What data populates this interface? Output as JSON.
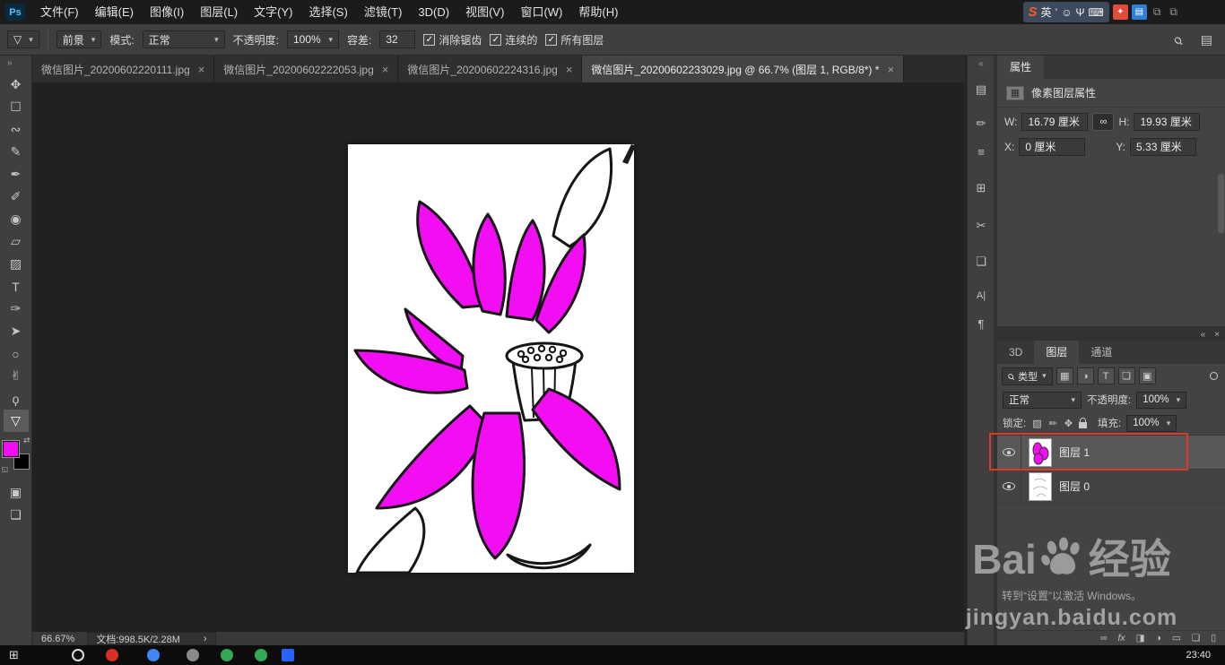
{
  "colors": {
    "flower": "#f20df2",
    "annotation": "#e0372b",
    "panel": "#434343",
    "menubar": "#1b1b1b"
  },
  "icons": {
    "ps_logo": "Ps",
    "collapse_right": "»",
    "collapse_left": "«",
    "close": "×",
    "arrow_down": "▾",
    "chevron_right": "›",
    "search": "ϙ",
    "check": "✓",
    "link": "∞",
    "swap": "⇄",
    "mini_swatch": "◱",
    "image_thumb": "▦",
    "window": "⧉",
    "start": "⊞"
  },
  "menu": {
    "items": [
      "文件(F)",
      "编辑(E)",
      "图像(I)",
      "图层(L)",
      "文字(Y)",
      "选择(S)",
      "滤镜(T)",
      "3D(D)",
      "视图(V)",
      "窗口(W)",
      "帮助(H)"
    ]
  },
  "tray": {
    "sogou": "S",
    "ime": "英",
    "apos": "’",
    "smiley": "☺",
    "mic": "Ψ",
    "keyboard": "⌨",
    "red_box": "✦",
    "blue_box": "▤"
  },
  "options": {
    "tool_glyph": "▽",
    "foreground": "前景",
    "mode_label": "模式:",
    "mode": "正常",
    "opacity_label": "不透明度:",
    "opacity": "100%",
    "tolerance_label": "容差:",
    "tolerance": "32",
    "cb_antialias": "消除锯齿",
    "cb_contiguous": "连续的",
    "cb_all_layers": "所有图层",
    "workspace_icon": "▤"
  },
  "tools": [
    {
      "name": "move",
      "glyph": "✥"
    },
    {
      "name": "marquee",
      "glyph": "☐"
    },
    {
      "name": "lasso",
      "glyph": "∾"
    },
    {
      "name": "quick-select",
      "glyph": "✎"
    },
    {
      "name": "eyedropper",
      "glyph": "✒"
    },
    {
      "name": "brush",
      "glyph": "✐"
    },
    {
      "name": "clone-stamp",
      "glyph": "◉"
    },
    {
      "name": "eraser",
      "glyph": "▱"
    },
    {
      "name": "gradient",
      "glyph": "▨"
    },
    {
      "name": "type",
      "glyph": "T"
    },
    {
      "name": "pen",
      "glyph": "✑"
    },
    {
      "name": "path-select",
      "glyph": "➤"
    },
    {
      "name": "ellipse",
      "glyph": "○"
    },
    {
      "name": "hand",
      "glyph": "✌"
    },
    {
      "name": "zoom",
      "glyph": "ϙ"
    },
    {
      "name": "paint-bucket",
      "glyph": "▽"
    }
  ],
  "toolbar_extras": [
    {
      "name": "quick-mask",
      "glyph": "▣"
    },
    {
      "name": "screen-mode",
      "glyph": "❏"
    }
  ],
  "tabs": [
    {
      "label": "微信图片_20200602220111.jpg"
    },
    {
      "label": "微信图片_20200602222053.jpg"
    },
    {
      "label": "微信图片_20200602224316.jpg"
    },
    {
      "label": "微信图片_20200602233029.jpg @ 66.7% (图层 1, RGB/8*) *"
    }
  ],
  "statusbar": {
    "zoom": "66.67%",
    "doc": "文档:998.5K/2.28M"
  },
  "dock_icons": [
    {
      "name": "navigator",
      "glyph": "▤"
    },
    {
      "name": "brush-settings",
      "glyph": "✏"
    },
    {
      "name": "adjustments",
      "glyph": "≡"
    },
    {
      "name": "swatches",
      "glyph": "⊞"
    },
    {
      "name": "clip",
      "glyph": "✂"
    },
    {
      "name": "clone-source",
      "glyph": "❏"
    },
    {
      "name": "character",
      "glyph": "A|"
    },
    {
      "name": "paragraph",
      "glyph": "¶"
    }
  ],
  "properties": {
    "tab": "属性",
    "layer_type": "像素图层属性",
    "w_label": "W:",
    "w": "16.79 厘米",
    "h_label": "H:",
    "h": "19.93 厘米",
    "x_label": "X:",
    "x": "0 厘米",
    "y_label": "Y:",
    "y": "5.33 厘米"
  },
  "layers": {
    "tabs": [
      {
        "label": "3D"
      },
      {
        "label": "图层"
      },
      {
        "label": "通道"
      }
    ],
    "filter_label": "类型",
    "filters": [
      {
        "name": "pixel",
        "glyph": "▦"
      },
      {
        "name": "adjustment",
        "glyph": "◑"
      },
      {
        "name": "type",
        "glyph": "T"
      },
      {
        "name": "shape",
        "glyph": "❏"
      },
      {
        "name": "smart-object",
        "glyph": "▣"
      }
    ],
    "blend": "正常",
    "opacity_label": "不透明度:",
    "opacity": "100%",
    "lock_label": "锁定:",
    "lock_icons": [
      {
        "name": "lock-transparent",
        "glyph": "▨"
      },
      {
        "name": "lock-pixels",
        "glyph": "✏"
      },
      {
        "name": "lock-position",
        "glyph": "✥"
      }
    ],
    "fill_label": "填充:",
    "fill": "100%",
    "rows": [
      {
        "name": "图层 1"
      },
      {
        "name": "图层 0"
      }
    ],
    "footer": [
      {
        "name": "link-layers",
        "glyph": "∞"
      },
      {
        "name": "layer-style",
        "glyph": "fx"
      },
      {
        "name": "layer-mask",
        "glyph": "◨"
      },
      {
        "name": "adjustment-layer",
        "glyph": "◑"
      },
      {
        "name": "new-group",
        "glyph": "▭"
      },
      {
        "name": "new-layer",
        "glyph": "❏"
      },
      {
        "name": "delete-layer",
        "glyph": "▯"
      }
    ]
  },
  "watermark": {
    "brand_left": "Bai",
    "brand_right": "经验",
    "activate": "转到“设置”以激活 Windows。",
    "url": "jingyan.baidu.com"
  },
  "taskbar": {
    "time": "23:40"
  }
}
